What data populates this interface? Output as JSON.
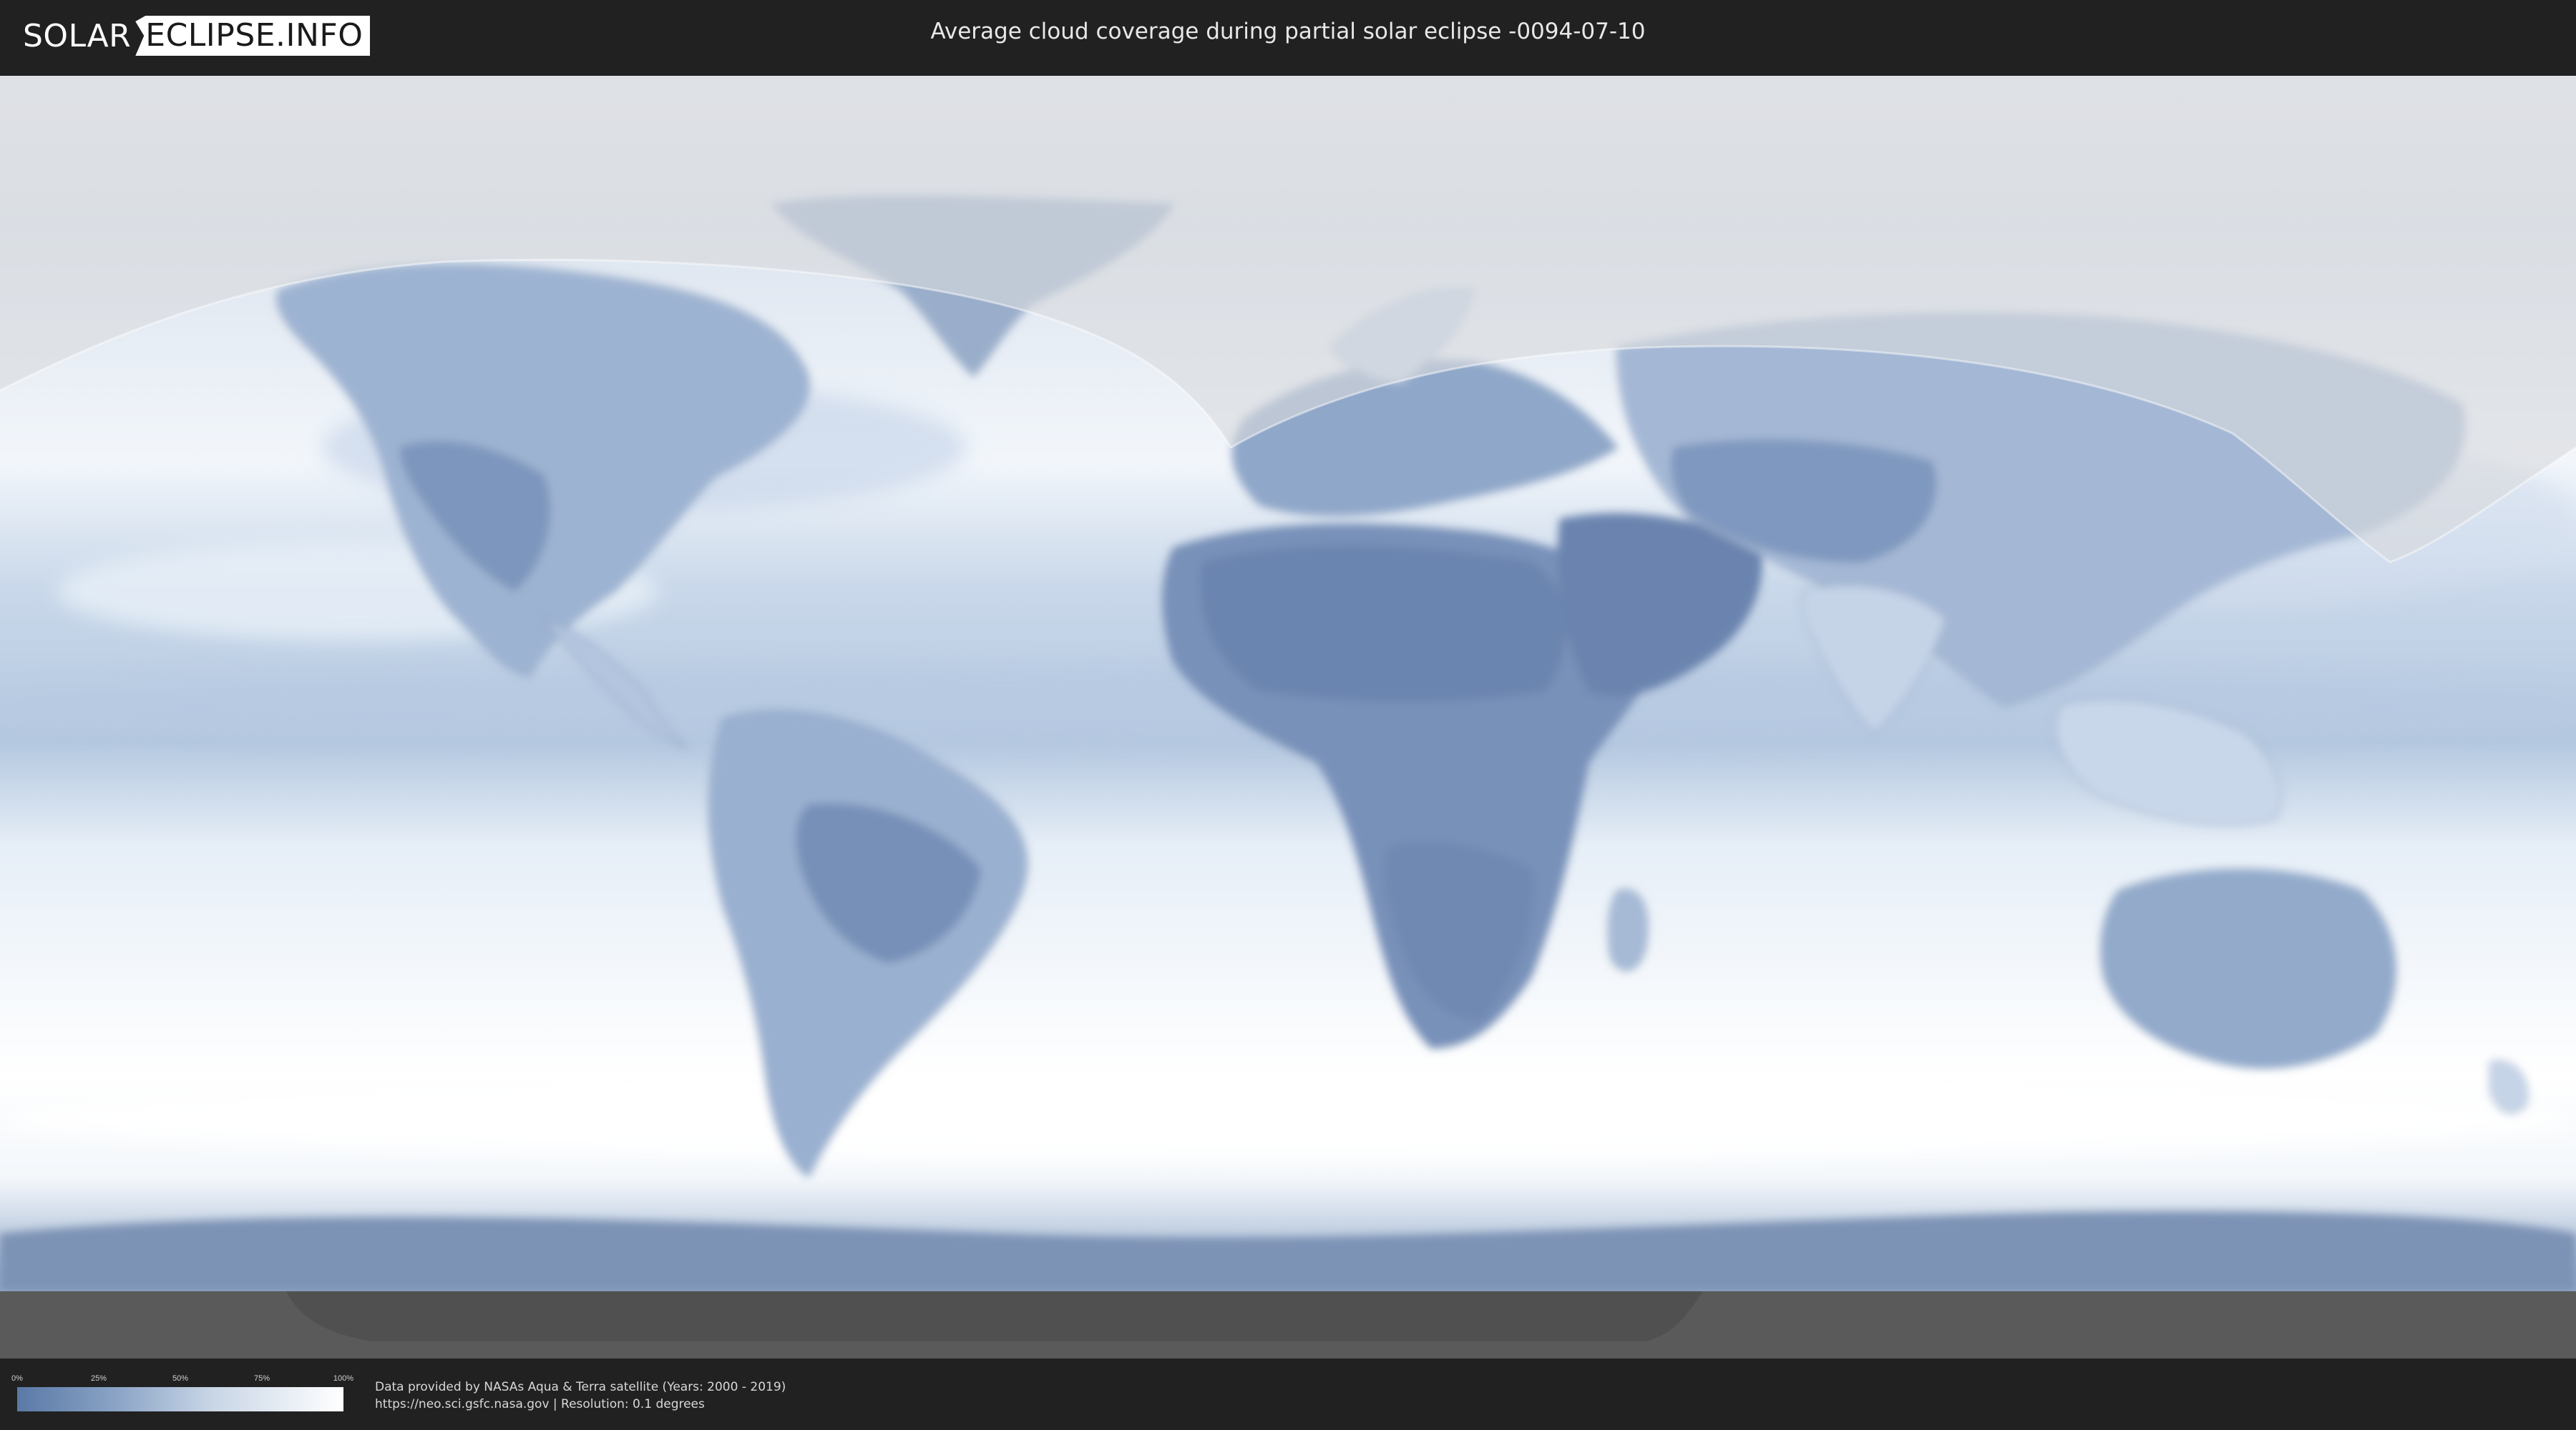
{
  "header": {
    "logo_part1": "SOLAR",
    "logo_part2": "ECLIPSE.INFO",
    "title": "Average cloud coverage during partial solar eclipse -0094-07-10"
  },
  "legend": {
    "ticks": [
      "0%",
      "25%",
      "50%",
      "75%",
      "100%"
    ],
    "tick_positions_pct": [
      0,
      25,
      50,
      75,
      100
    ],
    "color_low": "#5a79a6",
    "color_high": "#ffffff"
  },
  "credits": {
    "line1": "Data provided by NASAs Aqua & Terra satellite (Years: 2000 - 2019)",
    "line2": "https://neo.sci.gsfc.nasa.gov | Resolution: 0.1 degrees"
  },
  "map": {
    "projection": "equirectangular",
    "layer": "average cloud coverage",
    "overlay": "partial eclipse visibility zone",
    "colors": {
      "clear_sky": "#5a79a6",
      "cloudy": "#ffffff",
      "ocean_base": "#dfe8f3",
      "outside_zone_tint": "#d8dadd",
      "below_horizon": "#5a5a5a"
    }
  }
}
